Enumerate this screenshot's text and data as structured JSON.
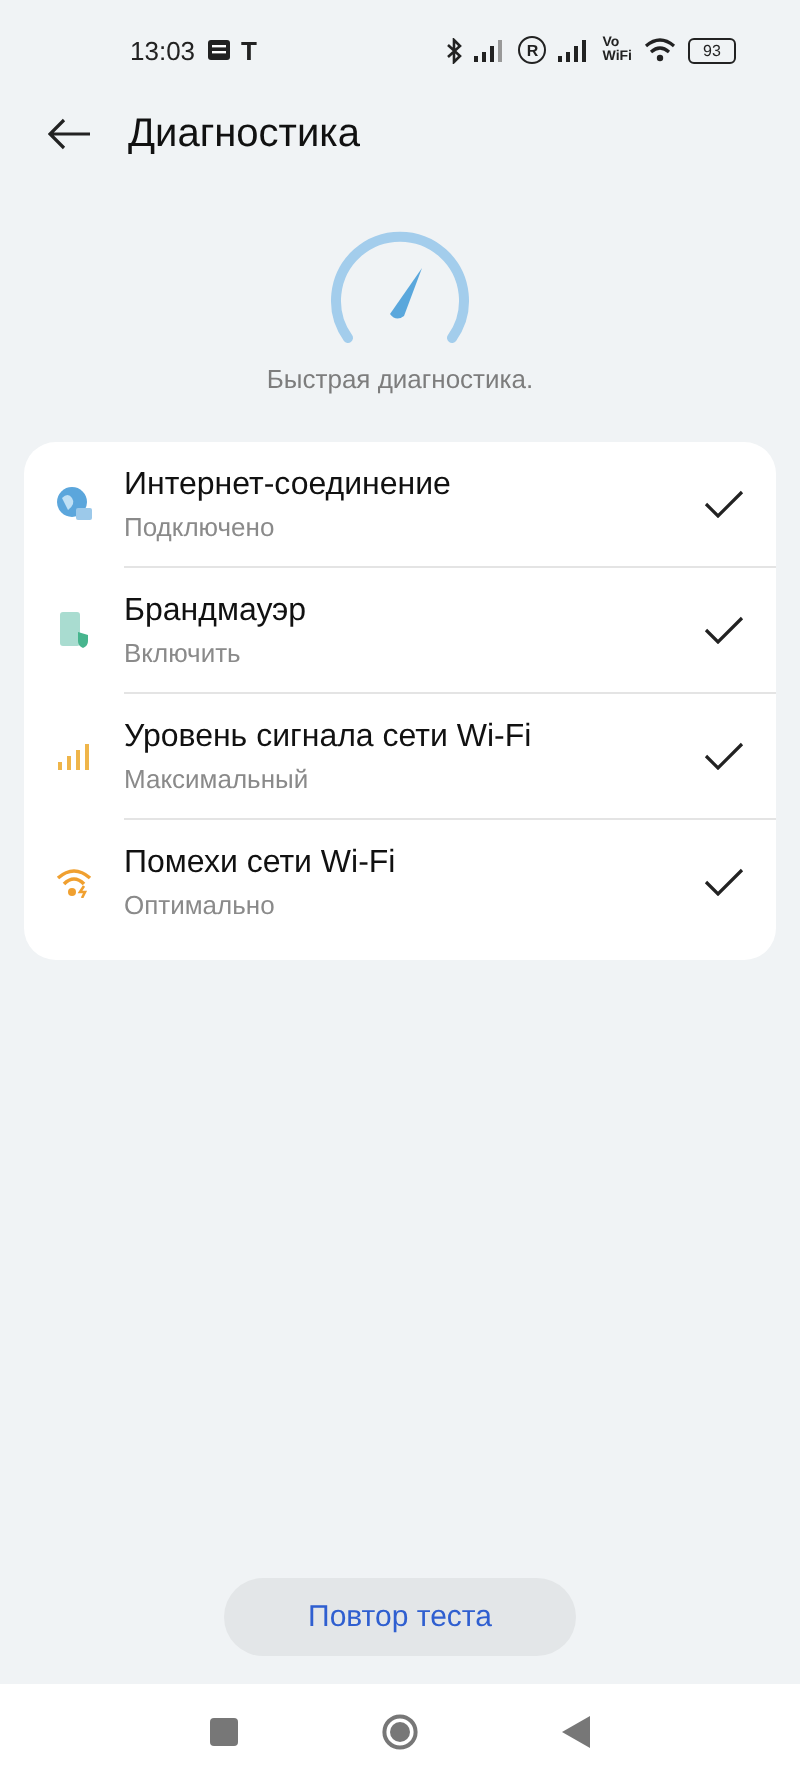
{
  "status_bar": {
    "time": "13:03",
    "carrier_glyph": "T",
    "roaming_mark": "R",
    "volte": [
      "Vo",
      "WiFi"
    ],
    "battery": "93"
  },
  "header": {
    "title": "Диагностика"
  },
  "caption": "Быстрая диагностика.",
  "checks": [
    {
      "kind": "internet",
      "title": "Интернет-соединение",
      "status": "Подключено",
      "passed": true
    },
    {
      "kind": "firewall",
      "title": "Брандмауэр",
      "status": "Включить",
      "passed": true
    },
    {
      "kind": "signal",
      "title": "Уровень сигнала сети Wi-Fi",
      "status": "Максимальный",
      "passed": true
    },
    {
      "kind": "interference",
      "title": "Помехи сети Wi-Fi",
      "status": "Оптимально",
      "passed": true
    }
  ],
  "retest_button": "Повтор теста"
}
